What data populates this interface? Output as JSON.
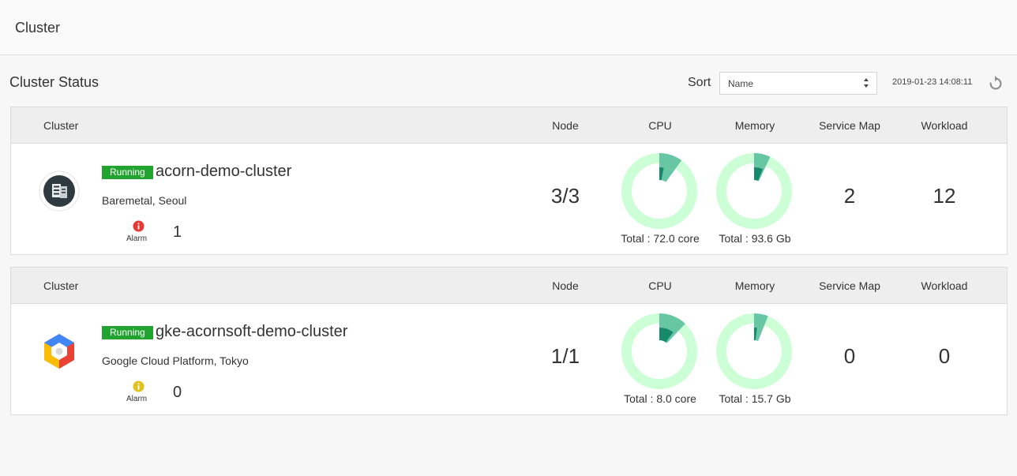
{
  "header": {
    "title": "Cluster"
  },
  "status": {
    "title": "Cluster Status",
    "sort_label": "Sort",
    "sort_value": "Name",
    "timestamp": "2019-01-23 14:08:11"
  },
  "columns": {
    "cluster": "Cluster",
    "node": "Node",
    "cpu": "CPU",
    "memory": "Memory",
    "service_map": "Service Map",
    "workload": "Workload"
  },
  "clusters": [
    {
      "status": "Running",
      "name": "acorn-demo-cluster",
      "location": "Baremetal, Seoul",
      "alarm_label": "Alarm",
      "alarm_count": "1",
      "alarm_color": "#e53935",
      "logo_icon": "server-icon",
      "node": "3/3",
      "cpu_total": "Total : 72.0 core",
      "cpu_usage": [
        0.1,
        0.03
      ],
      "memory_total": "Total : 93.6 Gb",
      "memory_usage": [
        0.07,
        0.06
      ],
      "service_map": "2",
      "workload": "12"
    },
    {
      "status": "Running",
      "name": "gke-acornsoft-demo-cluster",
      "location": "Google Cloud Platform, Tokyo",
      "alarm_label": "Alarm",
      "alarm_count": "0",
      "alarm_color": "#e0c21f",
      "logo_icon": "gcp-icon",
      "node": "1/1",
      "cpu_total": "Total : 8.0 core",
      "cpu_usage": [
        0.12,
        0.1
      ],
      "memory_total": "Total : 15.7 Gb",
      "memory_usage": [
        0.06,
        0.02
      ],
      "service_map": "0",
      "workload": "0"
    }
  ],
  "colors": {
    "running": "#21a42f",
    "donut_track": "#ccffd5",
    "donut_primary": "#67c6a3",
    "donut_secondary": "#188a6c"
  }
}
